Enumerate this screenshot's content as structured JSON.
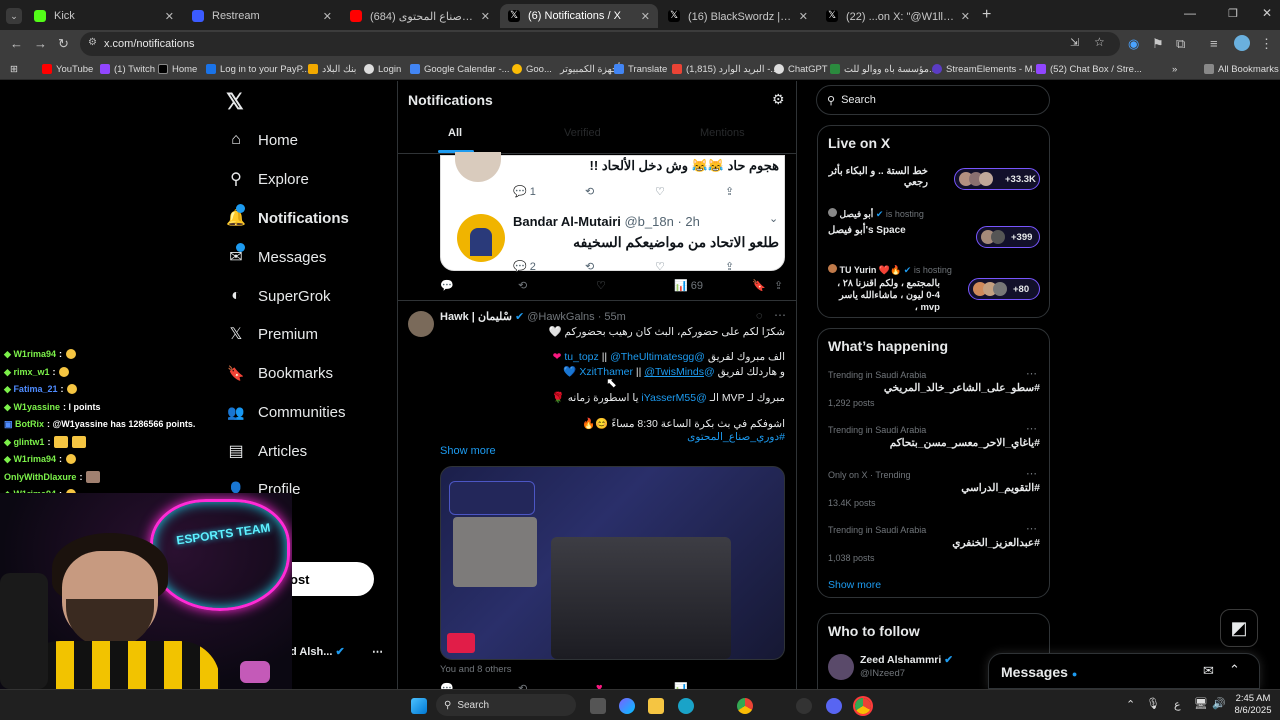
{
  "browser": {
    "tabs": [
      {
        "title": "Kick",
        "color": "#53fc18"
      },
      {
        "title": "Restream",
        "color": "#3b5bff"
      },
      {
        "title": "(684) دوري صناع المحتوى - ...",
        "color": "#ff0000"
      },
      {
        "title": "(6) Notifications / X",
        "color": "#ffffff"
      },
      {
        "title": "(16) BlackSwordz | صالح (@Rea...",
        "color": "#ffffff"
      },
      {
        "title": "(22) ...on X: \"@W1llyv 3-0 يو هه",
        "color": "#ffffff"
      }
    ],
    "url": "x.com/notifications",
    "bookmarks": [
      "YouTube",
      "(1) Twitch",
      "Home",
      "Log in to your PayP...",
      "بنك البلاد",
      "Login",
      "Google Calendar -...",
      "Goo...",
      "أجهزة الكمبيوتر",
      "Translate",
      "البريد الوارد (1,815) -...",
      "ChatGPT",
      "مؤسسة باه ووالو للت...",
      "StreamElements - M...",
      "(52) Chat Box / Stre...",
      "All Bookmarks"
    ]
  },
  "nav": {
    "items": [
      {
        "label": "Home",
        "icon": "home-icon",
        "glyph": "⌂"
      },
      {
        "label": "Explore",
        "icon": "search-icon",
        "glyph": "⚲"
      },
      {
        "label": "Notifications",
        "icon": "bell-icon",
        "glyph": "🔔"
      },
      {
        "label": "Messages",
        "icon": "mail-icon",
        "glyph": "✉"
      },
      {
        "label": "SuperGrok",
        "icon": "grok-icon",
        "glyph": "◐"
      },
      {
        "label": "Premium",
        "icon": "x-logo-icon",
        "glyph": "𝕏"
      },
      {
        "label": "Bookmarks",
        "icon": "bookmark-icon",
        "glyph": "🔖"
      },
      {
        "label": "Communities",
        "icon": "people-icon",
        "glyph": "👥"
      },
      {
        "label": "Articles",
        "icon": "article-icon",
        "glyph": "▤"
      },
      {
        "label": "Profile",
        "icon": "person-icon",
        "glyph": "👤"
      }
    ],
    "post_label": "ost",
    "account_name": "d Alsh..."
  },
  "notifications": {
    "title": "Notifications",
    "tabs": [
      "All",
      "Verified",
      "Mentions"
    ],
    "quoted_top_text": "هجوم حاد 😹😹 وش دخل الألحاد !!",
    "quoted_reply_counts": [
      "1"
    ],
    "quoted2_name": "Bandar Al-Mutairi",
    "quoted2_handle": "@b_18n · 2h",
    "quoted2_text": "طلعو الاتحاد من مواضيعكم السخيفه",
    "quoted2_reply": "2",
    "post1_views": "69",
    "post": {
      "name": "Hawk | سْليمان",
      "handle": "@HawkGalns · 55m",
      "line1": "شكرًا لكم على حضوركم، البث كان رهيب بحضوركم 🤍",
      "line2_pre": "الف مبروك لفريق",
      "mention1": "@tu_topz",
      "mention2": "@TheUltimatesgg",
      "line3_pre": "و هاردلك لفريق",
      "mention3": "@XzitThamer",
      "mention4": "@TwisMinds",
      "line4": "مبروك لـ MVP الـ",
      "mention5": "@iYasserM55",
      "line4_post": "يا اسطورة زمانه 🌹",
      "line5": "اشوفكم في بث بكرة الساعة 8:30 مساءً 😊🔥",
      "hashtag": "#دوري_صناع_المحتوى",
      "show_more": "Show more",
      "liked_by": "You and 8 others"
    }
  },
  "sidebar": {
    "search_placeholder": "Search",
    "live_title": "Live on X",
    "live": [
      {
        "host": "",
        "status": "",
        "title": "خط الستة .. و البكاء بأثر رجعي",
        "count": "+33.3K"
      },
      {
        "host": "أبو فيصل",
        "status": "is hosting",
        "title": "أبو فيصل's Space",
        "count": "+399"
      },
      {
        "host": "TU Yurin ❤️🔥",
        "status": "is hosting",
        "title": "بالمجتمع ، ولكم اقنزنا ۲۸ ، 4-0 ليون ، ماشاءالله ياسر mvp ،",
        "count": "+80"
      }
    ],
    "happening_title": "What’s happening",
    "trends": [
      {
        "context": "Trending in Saudi Arabia",
        "name": "#سطو_على_الشاعر_خالد_المريخي",
        "posts": "1,292 posts"
      },
      {
        "context": "Trending in Saudi Arabia",
        "name": "#ياغاي_الاحر_معسر_مسن_بتحاكم",
        "posts": ""
      },
      {
        "context": "Only on X · Trending",
        "name": "#التقويم_الدراسي",
        "posts": "13.4K posts"
      },
      {
        "context": "Trending in Saudi Arabia",
        "name": "#عبدالعزيز_الخنفري",
        "posts": "1,038 posts"
      }
    ],
    "show_more": "Show more",
    "follow_title": "Who to follow",
    "follow_name": "Zeed Alshammri",
    "follow_handle": "@INzeed7",
    "messages_label": "Messages"
  },
  "chat": [
    {
      "user": "W1rima94",
      "text": ":"
    },
    {
      "user": "rimx_w1",
      "text": ":"
    },
    {
      "user": "Fatima_21",
      "text": ":"
    },
    {
      "user": "W1yassine",
      "text": ": l points"
    },
    {
      "user": "BotRix",
      "text": ": @W1yassine has 1286566 points."
    },
    {
      "user": "glintw1",
      "text": ":"
    },
    {
      "user": "W1rima94",
      "text": ":"
    },
    {
      "user": "OnlyWithDlaxure",
      "text": ":"
    },
    {
      "user": "W1rima94",
      "text": ":"
    }
  ],
  "overlay": {
    "banner": "ESPORTS TEAM"
  },
  "taskbar": {
    "search": "Search",
    "time": "2:45 AM",
    "date": "8/6/2025",
    "lang": "ع"
  }
}
